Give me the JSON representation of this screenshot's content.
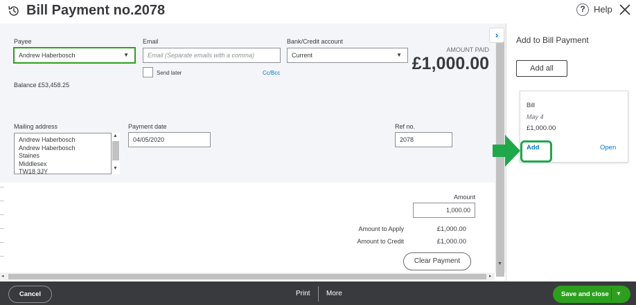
{
  "header": {
    "title": "Bill Payment no.2078",
    "help_label": "Help"
  },
  "form": {
    "payee_label": "Payee",
    "payee_value": "Andrew Haberbosch",
    "email_label": "Email",
    "email_placeholder": "Email (Separate emails with a comma)",
    "send_later_label": "Send later",
    "cc_bcc_label": "Cc/Bcc",
    "bank_label": "Bank/Credit account",
    "bank_value": "Current",
    "amount_paid_label": "AMOUNT PAID",
    "amount_paid_value": "£1,000.00",
    "balance_text": "Balance £53,458.25",
    "mailing_label": "Mailing address",
    "mailing_lines": [
      "Andrew Haberbosch",
      "Andrew Haberbosch",
      "Staines",
      "Middlesex",
      "TW18 3JY"
    ],
    "payment_date_label": "Payment date",
    "payment_date_value": "04/05/2020",
    "ref_label": "Ref no.",
    "ref_value": "2078"
  },
  "totals": {
    "amount_label": "Amount",
    "amount_value": "1,000.00",
    "apply_label": "Amount to Apply",
    "apply_value": "£1,000.00",
    "credit_label": "Amount to Credit",
    "credit_value": "£1,000.00",
    "clear_button": "Clear Payment"
  },
  "side_panel": {
    "title": "Add to Bill Payment",
    "add_all_button": "Add all",
    "card": {
      "type": "Bill",
      "date": "May 4",
      "amount": "£1,000.00",
      "add_link": "Add",
      "open_link": "Open"
    }
  },
  "footer": {
    "cancel_button": "Cancel",
    "print_link": "Print",
    "more_link": "More",
    "save_button": "Save and close"
  },
  "colors": {
    "accent_green": "#2ca01c",
    "link_blue": "#0077c5",
    "footer_bg": "#393a3d",
    "highlight_green": "#1fa84a"
  }
}
